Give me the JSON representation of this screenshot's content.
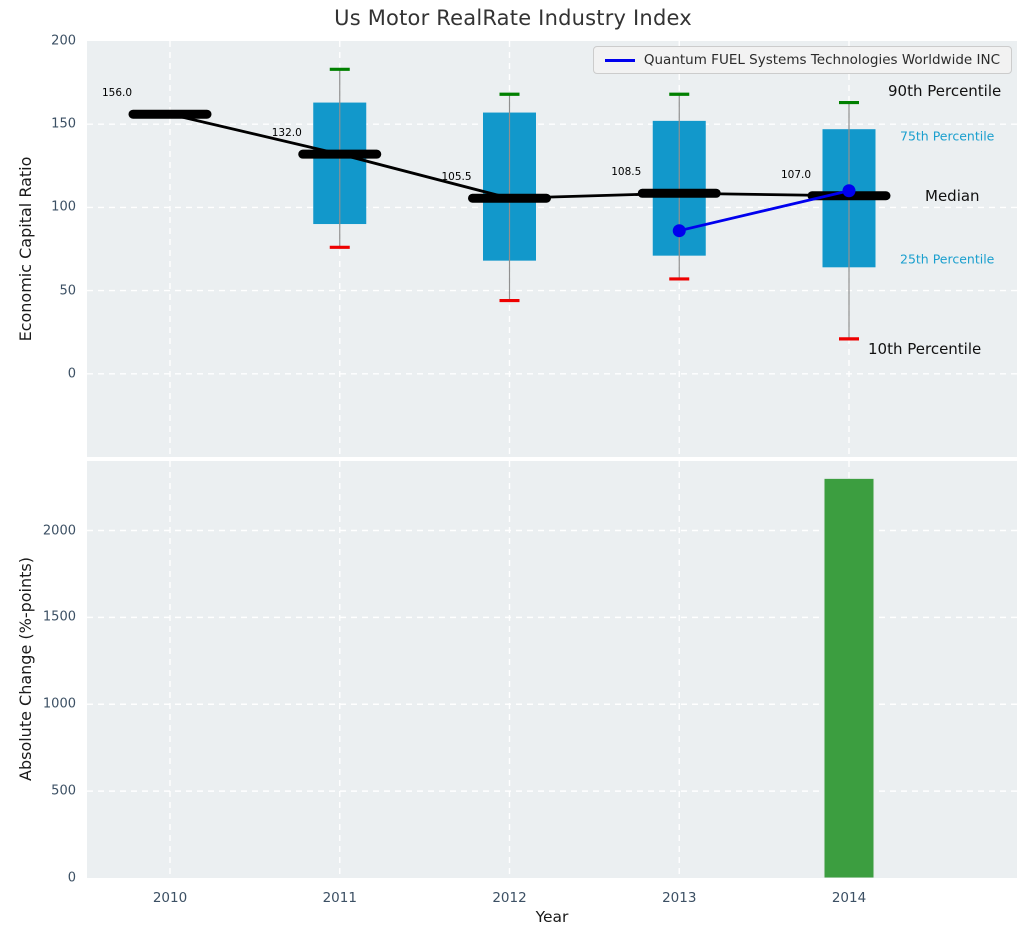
{
  "figure": {
    "title": "Us Motor RealRate Industry Index"
  },
  "legend": {
    "label": "Quantum FUEL Systems Technologies Worldwide INC"
  },
  "axis_labels": {
    "top_y": "Economic Capital Ratio",
    "bottom_y": "Absolute Change (%-points)",
    "x": "Year"
  },
  "colors": {
    "axes_bg": "#ebeff1",
    "grid": "#ffffff",
    "box_fill": "#1298cb",
    "whisker": "#909090",
    "cap_90th": "#008000",
    "cap_10th": "#ee0000",
    "median": "#000000",
    "company_line": "#0000ee",
    "bar_fill": "#3c9e40",
    "bar_edge": "#e8eced",
    "tick_label": "#3c5064",
    "annotation_minor": "#1a9fce",
    "annotation_major": "#111111",
    "title": "#333333"
  },
  "chart_data": [
    {
      "type": "boxplot",
      "title": "Us Motor RealRate Industry Index",
      "ylabel": "Economic Capital Ratio",
      "ylim": [
        -50,
        200
      ],
      "yticks": [
        0,
        50,
        100,
        150,
        200
      ],
      "categories": [
        "2010",
        "2011",
        "2012",
        "2013",
        "2014"
      ],
      "grid": true,
      "legend_position": "upper right",
      "boxes": [
        {
          "year": "2010",
          "median": 156.0,
          "median_label": "156.0",
          "p10": null,
          "p25": null,
          "p75": null,
          "p90": null
        },
        {
          "year": "2011",
          "median": 132.0,
          "median_label": "132.0",
          "p10": 76,
          "p25": 90,
          "p75": 163,
          "p90": 183
        },
        {
          "year": "2012",
          "median": 105.5,
          "median_label": "105.5",
          "p10": 44,
          "p25": 68,
          "p75": 157,
          "p90": 168
        },
        {
          "year": "2013",
          "median": 108.5,
          "median_label": "108.5",
          "p10": 57,
          "p25": 71,
          "p75": 152,
          "p90": 168
        },
        {
          "year": "2014",
          "median": 107.0,
          "median_label": "107.0",
          "p10": 21,
          "p25": 64,
          "p75": 147,
          "p90": 163
        }
      ],
      "series": [
        {
          "name": "Quantum FUEL Systems Technologies Worldwide INC",
          "x": [
            "2013",
            "2014"
          ],
          "values": [
            86,
            110
          ]
        }
      ],
      "annotations": [
        {
          "text": "90th Percentile",
          "value": 170,
          "style": "major"
        },
        {
          "text": "75th Percentile",
          "value": 143,
          "style": "minor"
        },
        {
          "text": "Median",
          "value": 107,
          "style": "major"
        },
        {
          "text": "25th Percentile",
          "value": 69,
          "style": "minor"
        },
        {
          "text": "10th Percentile",
          "value": 15,
          "style": "major"
        }
      ]
    },
    {
      "type": "bar",
      "ylabel": "Absolute Change (%-points)",
      "xlabel": "Year",
      "ylim": [
        0,
        2400
      ],
      "yticks": [
        0,
        500,
        1000,
        1500,
        2000
      ],
      "categories": [
        "2010",
        "2011",
        "2012",
        "2013",
        "2014"
      ],
      "values": [
        null,
        null,
        null,
        null,
        2300
      ]
    }
  ]
}
